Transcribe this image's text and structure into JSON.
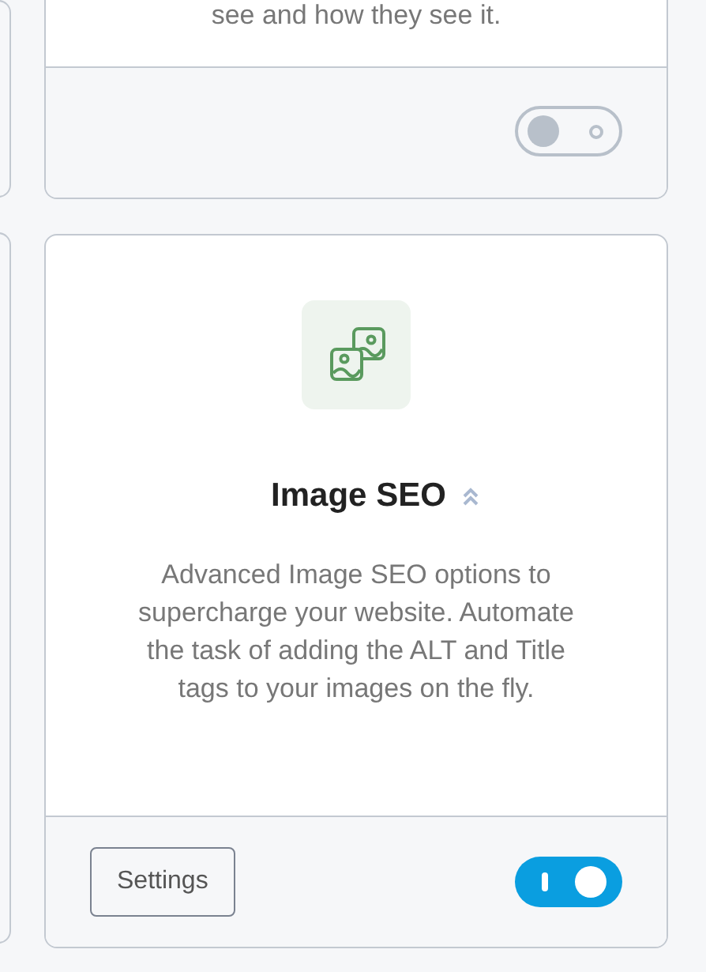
{
  "cards": [
    {
      "description": "see and how they see it.",
      "enabled": false
    },
    {
      "title": "Image SEO",
      "description": "Advanced Image SEO options to supercharge your website. Automate the task of adding the ALT and Title tags to your images on the fly.",
      "settings_button": "Settings",
      "enabled": true
    }
  ]
}
